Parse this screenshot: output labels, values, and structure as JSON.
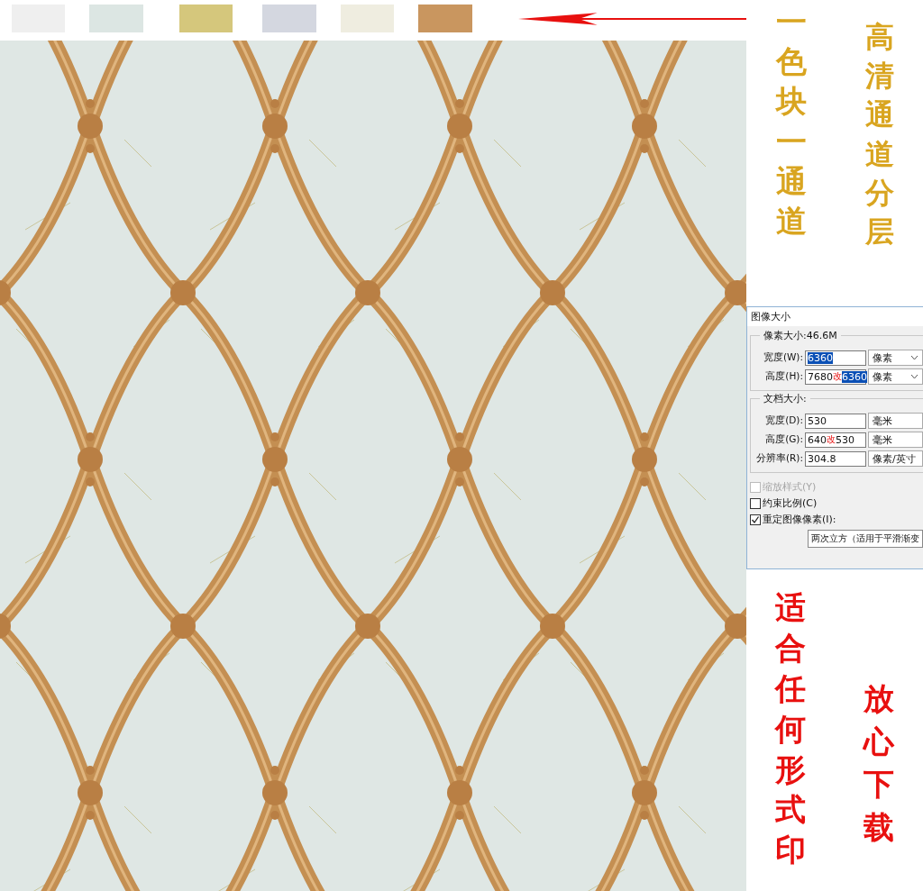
{
  "swatches": [
    {
      "color": "#efefef"
    },
    {
      "color": "#dce6e3"
    },
    {
      "color": "#d5c77c"
    },
    {
      "color": "#d4d7e0"
    },
    {
      "color": "#efede0"
    },
    {
      "color": "#c9965f"
    }
  ],
  "top_captions": [
    {
      "text": "一色块一通道",
      "kind": "gold"
    },
    {
      "text": "高清通道分层",
      "kind": "gold"
    }
  ],
  "dialog": {
    "title": "图像大小",
    "pixel_group": {
      "title": "像素大小:46.6M",
      "rows": [
        {
          "label": "宽度(W):",
          "value": "6360",
          "selected": true,
          "unit": "像素",
          "dropdown": true
        },
        {
          "label": "高度(H):",
          "value": "7680",
          "mark": "改",
          "new_value": "6360",
          "selected": true,
          "unit": "像素",
          "dropdown": true
        }
      ]
    },
    "document_group": {
      "title": "文档大小:",
      "rows": [
        {
          "label": "宽度(D):",
          "value": "530",
          "selected": false,
          "unit": "毫米",
          "dropdown": false
        },
        {
          "label": "高度(G):",
          "value": "640",
          "mark": "改",
          "new_value": "530",
          "selected": false,
          "unit": "毫米",
          "dropdown": false
        },
        {
          "label": "分辨率(R):",
          "value": "304.8",
          "selected": false,
          "unit": "像素/英寸",
          "dropdown": false
        }
      ]
    },
    "options": [
      {
        "label": "缩放样式(Y)",
        "checked": false,
        "disabled": true
      },
      {
        "label": "约束比例(C)",
        "checked": false,
        "disabled": false
      },
      {
        "label": "重定图像像素(I):",
        "checked": true,
        "disabled": false
      }
    ],
    "resample": "两次立方（适用于平滑渐变"
  },
  "bottom_captions": [
    {
      "text": "适合任何形式印",
      "kind": "red"
    },
    {
      "text": "放心下载",
      "kind": "red"
    }
  ]
}
